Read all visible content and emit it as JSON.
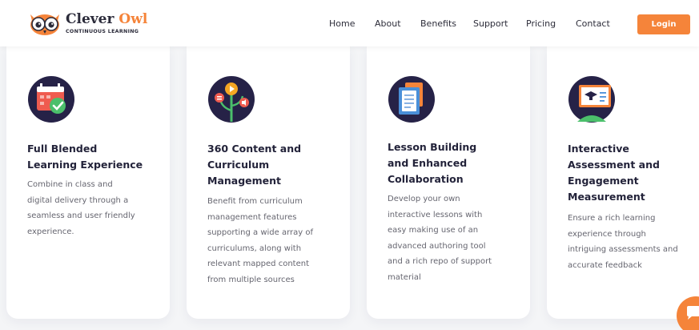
{
  "brand": {
    "name_main": "Clever",
    "name_accent": "Owl",
    "tagline": "CONTINUOUS LEARNING"
  },
  "nav": {
    "items": [
      "Home",
      "About",
      "Benefits",
      "Support",
      "Pricing",
      "Contact"
    ],
    "login_label": "Login"
  },
  "colors": {
    "accent": "#f5843a",
    "navy": "#262247",
    "text": "#23233a"
  },
  "features": [
    {
      "icon": "calendar-check-icon",
      "title_lines": [
        "Full Blended",
        "Learning Experience"
      ],
      "desc_lines": [
        "Combine in class and",
        "digital delivery through a",
        "seamless and user friendly",
        "experience."
      ]
    },
    {
      "icon": "content-plant-icon",
      "title_lines": [
        "360 Content and",
        "Curriculum",
        "Management"
      ],
      "desc_lines": [
        "Benefit from curriculum",
        "management features",
        "supporting a wide array of",
        "curriculums, along with",
        "relevant mapped content",
        "from multiple sources"
      ]
    },
    {
      "icon": "documents-icon",
      "title_lines": [
        "Lesson Building",
        "and Enhanced",
        "Collaboration"
      ],
      "desc_lines": [
        "Develop your own",
        "interactive lessons with",
        "easy making use of an",
        "advanced authoring tool",
        "and a rich repo of support",
        "material"
      ]
    },
    {
      "icon": "presentation-board-icon",
      "title_lines": [
        "Interactive",
        "Assessment and",
        "Engagement",
        "Measurement"
      ],
      "desc_lines": [
        "Ensure a rich learning",
        "experience through",
        "intriguing assessments and",
        "accurate feedback"
      ]
    }
  ],
  "chat": {
    "icon": "chat-bubble-icon"
  }
}
